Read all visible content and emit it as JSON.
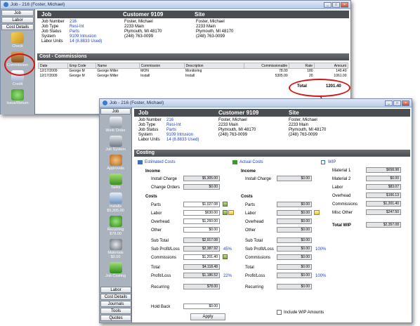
{
  "win1": {
    "title": "Job - 216 (Foster, Michael)",
    "tabs": [
      "Job",
      "Labor",
      "Cost Details"
    ],
    "side_icons": [
      {
        "label": "Check",
        "icon": "pencil-icon"
      },
      {
        "label": "Commission",
        "icon": "treasure-chest-icon"
      },
      {
        "label": "Credit",
        "icon": "credit-document-icon"
      },
      {
        "label": "Issue/Return",
        "icon": "issue-return-icon"
      }
    ],
    "header": {
      "col1": "Job",
      "col2": "Customer 9109",
      "col3": "Site"
    },
    "fields": [
      {
        "label": "Job Number",
        "value": "216",
        "c2": "Foster, Michael",
        "c3": "Foster, Michael"
      },
      {
        "label": "Job Type",
        "value": "Resi-Int",
        "c2": "2233 Main",
        "c3": "2233 Main"
      },
      {
        "label": "Job Status",
        "value": "Parts",
        "c2": "Plymouth, MI 48170",
        "c3": "Plymouth, MI 48170"
      },
      {
        "label": "System",
        "value": "9109 Intrusion",
        "c2": "(248) 763-0099",
        "c3": "(248) 763-0099"
      },
      {
        "label": "Labor Units",
        "value": "14 (8.8833 Used)",
        "c2": "",
        "c3": ""
      }
    ],
    "section": "Cost - Commissions",
    "columns": [
      "Date",
      "Emp Code",
      "Name",
      "Commission",
      "Description",
      "Commissionable",
      "Rate",
      "Amount"
    ],
    "rows": [
      [
        "12/17/2009",
        "George M",
        "George Miller",
        "MON",
        "Monitoring",
        "78.00",
        "180",
        "140.40"
      ],
      [
        "12/17/2009",
        "George M",
        "George Miller",
        "Install",
        "Install",
        "5305.00",
        "20",
        "1061.00"
      ]
    ],
    "total_label": "Total",
    "total_value": "1201.40"
  },
  "win2": {
    "title": "Job - 216 (Foster, Michael)",
    "top_tab": "Job",
    "side_icons": [
      {
        "label": "Work Order",
        "icon": "work-order-icon"
      },
      {
        "label": "Job System",
        "icon": "job-system-icon"
      },
      {
        "label": "Approvals",
        "icon": "approvals-icon"
      },
      {
        "label": "Tasks",
        "icon": "tasks-icon"
      },
      {
        "label": "Installs\n$5,305.00",
        "icon": "installs-icon"
      },
      {
        "label": "Recurring\n$78.00",
        "icon": "recurring-icon"
      },
      {
        "label": "Materials\n$0.00",
        "icon": "materials-icon"
      },
      {
        "label": "Job Costing",
        "icon": "job-costing-icon"
      }
    ],
    "bottom_tabs": [
      "Labor",
      "Cost Details",
      "Journals",
      "Tools",
      "Quotes"
    ],
    "header": {
      "col1": "Job",
      "col2": "Customer 9109",
      "col3": "Site"
    },
    "fields": [
      {
        "label": "Job Number",
        "value": "216",
        "c2": "Foster, Michael",
        "c3": "Foster, Michael"
      },
      {
        "label": "Job Type",
        "value": "Resi-Int",
        "c2": "2233 Main",
        "c3": "2233 Main"
      },
      {
        "label": "Job Status",
        "value": "Parts",
        "c2": "Plymouth, MI 48170",
        "c3": "Plymouth, MI 48170"
      },
      {
        "label": "System",
        "value": "9109 Intrusion",
        "c2": "(248) 763-0099",
        "c3": "(248) 763-0099"
      },
      {
        "label": "Labor Units",
        "value": "14 (8.8833 Used)",
        "c2": "",
        "c3": ""
      }
    ],
    "section": "Costing",
    "est_title": "Estimated Costs",
    "act_title": "Actual Costs",
    "wip_title": "WIP",
    "income": "Income",
    "costs": "Costs",
    "est": {
      "install_charge": "$5,305.00",
      "change_orders": "$0.00",
      "parts": "$1,027.08",
      "labor": "$630.00",
      "overhead": "$1,260.00",
      "other": "$0.00",
      "sub_total": "$2,917.08",
      "sub_profit": "$2,387.92",
      "sub_pct": "45%",
      "commissions": "$1,201.40",
      "total": "$4,118.48",
      "profit": "$1,186.52",
      "profit_pct": "22%",
      "recurring": "$78.00",
      "hold_back": "$0.00"
    },
    "act": {
      "install_charge": "$0.00",
      "parts": "$0.00",
      "labor": "$0.00",
      "overhead": "$0.00",
      "other": "$0.00",
      "sub_total": "$0.00",
      "sub_profit": "$0.00",
      "sub_pct": "100%",
      "commissions": "$0.00",
      "total": "$0.00",
      "profit": "$0.00",
      "profit_pct": "100%",
      "recurring": "$0.00"
    },
    "labels": {
      "install_charge": "Install Charge",
      "change_orders": "Change Orders",
      "parts": "Parts",
      "labor": "Labor",
      "overhead": "Overhead",
      "other": "Other",
      "sub_total": "Sub Total",
      "sub_profit": "Sub Profit/Loss",
      "commissions": "Commissions",
      "total": "Total",
      "profit": "Profit/Loss",
      "recurring": "Recurring",
      "hold_back": "Hold Back"
    },
    "wip": [
      {
        "label": "Material 1",
        "value": "$658.98"
      },
      {
        "label": "Material 2",
        "value": "$0.00"
      },
      {
        "label": "Labor",
        "value": "$83.07"
      },
      {
        "label": "Overhead",
        "value": "$166.13"
      },
      {
        "label": "Commissions",
        "value": "$1,201.40"
      },
      {
        "label": "Misc Other",
        "value": "$247.50"
      }
    ],
    "total_wip_label": "Total WIP",
    "total_wip_value": "$2,357.08",
    "include_wip": "Include WIP Amounts",
    "apply": "Apply"
  }
}
